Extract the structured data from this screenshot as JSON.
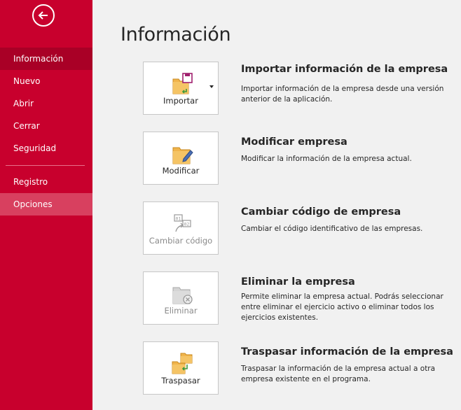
{
  "sidebar": {
    "back_label": "Atrás",
    "items": [
      {
        "label": "Información"
      },
      {
        "label": "Nuevo"
      },
      {
        "label": "Abrir"
      },
      {
        "label": "Cerrar"
      },
      {
        "label": "Seguridad"
      },
      {
        "label": "Registro"
      },
      {
        "label": "Opciones"
      }
    ],
    "selected": "Información",
    "hovered": "Opciones"
  },
  "main": {
    "title": "Información",
    "sections": [
      {
        "button_label": "Importar",
        "icon": "import-folder-save-icon",
        "has_dropdown": true,
        "enabled": true,
        "title": "Importar información de la empresa",
        "description": "Importar información de la empresa desde una versión anterior de la aplicación."
      },
      {
        "button_label": "Modificar",
        "icon": "folder-pencil-icon",
        "has_dropdown": false,
        "enabled": true,
        "title": "Modificar empresa",
        "description": "Modificar la información de la empresa actual."
      },
      {
        "button_label": "Cambiar código",
        "icon": "change-code-icon",
        "has_dropdown": false,
        "enabled": false,
        "title": "Cambiar código de empresa",
        "description": "Cambiar el código identificativo de las empresas."
      },
      {
        "button_label": "Eliminar",
        "icon": "delete-folder-icon",
        "has_dropdown": false,
        "enabled": false,
        "title": "Eliminar la empresa",
        "description": "Permite eliminar la empresa actual. Podrás seleccionar entre eliminar el ejercicio activo o eliminar todos los ejercicios existentes."
      },
      {
        "button_label": "Traspasar",
        "icon": "transfer-folders-icon",
        "has_dropdown": false,
        "enabled": true,
        "title": "Traspasar información de la empresa",
        "description": "Traspasar la información de la empresa actual a otra empresa existente en el programa."
      }
    ]
  },
  "colors": {
    "accent": "#c8002d",
    "selected_nav": "#a90026",
    "hover_nav": "#d8405f",
    "background": "#f1f1f1",
    "folder": "#f0b44c",
    "save_icon": "#a0206e",
    "arrow_green": "#3c9a3c"
  }
}
